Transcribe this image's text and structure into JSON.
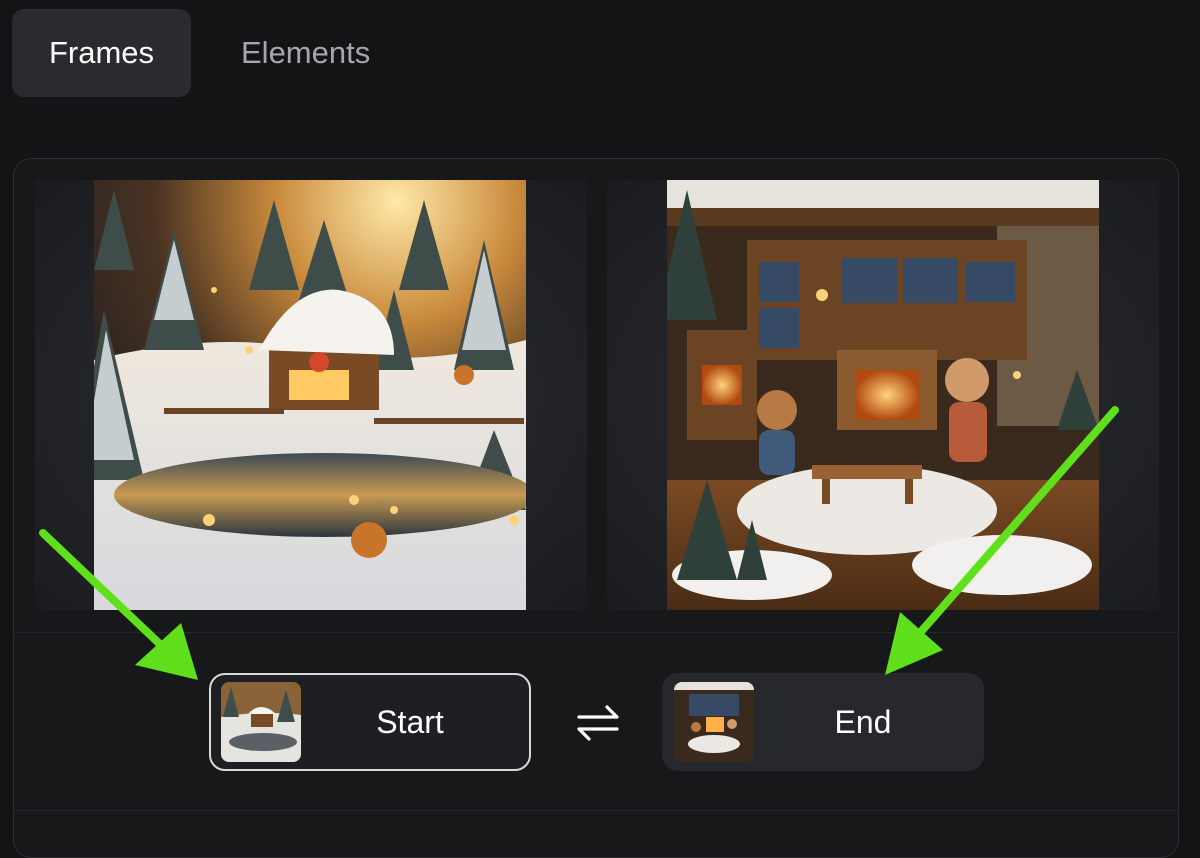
{
  "tabs": [
    {
      "label": "Frames",
      "active": true
    },
    {
      "label": "Elements",
      "active": false
    }
  ],
  "frames": {
    "start": {
      "label": "Start",
      "image": "snowy-village-cabin"
    },
    "end": {
      "label": "End",
      "image": "cozy-cabin-interior-with-figurines"
    },
    "swap_icon": "swap-arrows-icon"
  },
  "annotations": {
    "arrow_color": "#5fe01a"
  },
  "colors": {
    "background": "#131416",
    "active_tab": "#2a2b2e",
    "start_border": "#d9d9d9"
  }
}
